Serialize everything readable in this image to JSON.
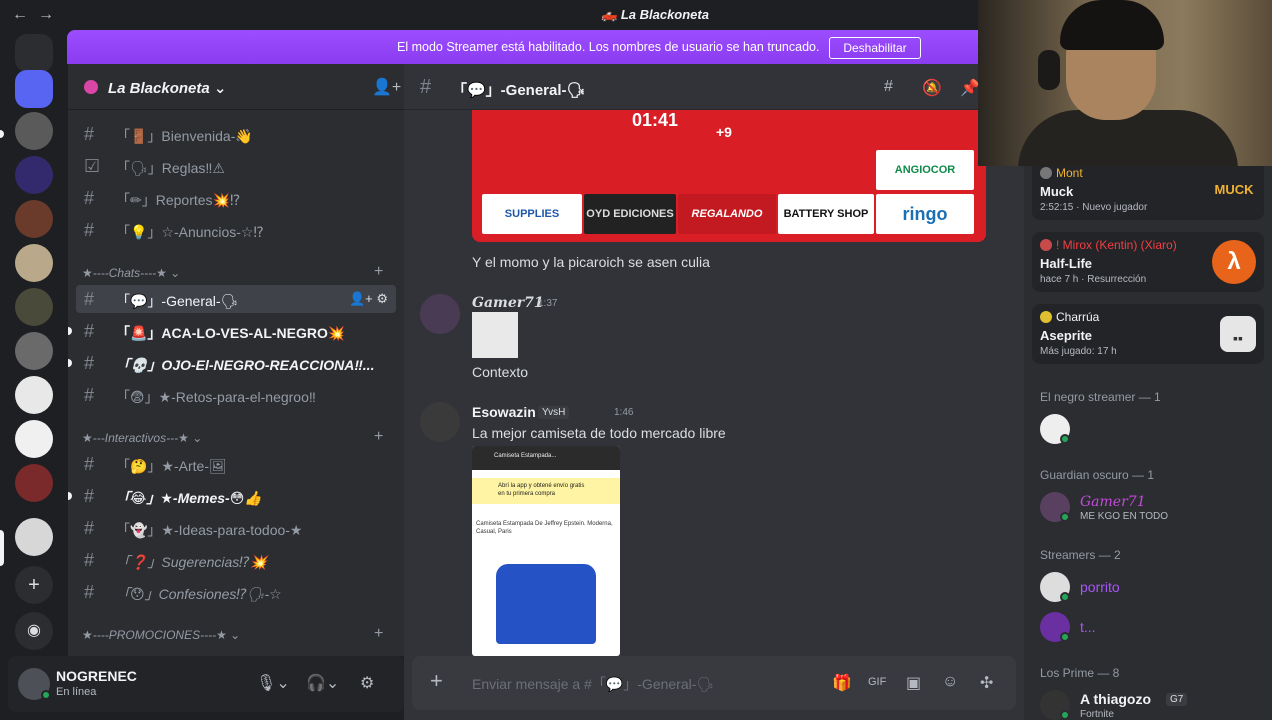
{
  "window": {
    "title": "La Blackoneta"
  },
  "banner": {
    "text": "El modo Streamer está habilitado. Los nombres de usuario se han truncado.",
    "button": "Deshabilitar"
  },
  "server": {
    "name": "La Blackoneta"
  },
  "channels": [
    {
      "label": "「🚪」Bienvenida-👋",
      "bold": false
    },
    {
      "label": "「🗣」Reglas‼⚠",
      "bold": false
    },
    {
      "label": "「✏」Reportes💥⁉",
      "bold": false
    },
    {
      "label": "「💡」☆-Anuncios-☆⁉",
      "bold": false
    }
  ],
  "categories": {
    "chats": "★----Chats----★",
    "interactivos": "★---Interactivos---★",
    "promociones": "★----PROMOCIONES----★"
  },
  "chat_channels": [
    {
      "label": "「💬」-General-🗣",
      "active": true
    },
    {
      "label": "「🚨」ACA-LO-VES-AL-NEGRO💥",
      "bold": true
    },
    {
      "label": "「💀」OJO-El-NEGRO-REACCIONA‼...",
      "bold": true
    },
    {
      "label": "「😨」★-Retos-para-el-negroo‼",
      "bold": false
    }
  ],
  "interactive_channels": [
    {
      "label": "「🤔」★-Arte-🖼",
      "bold": false
    },
    {
      "label": "「😂」★-Memes-😳👍",
      "bold": true
    },
    {
      "label": "「👻」★-Ideas-para-todoo-★",
      "bold": false
    },
    {
      "label": "「❓」Sugerencias⁉💥",
      "bold": false
    },
    {
      "label": "「😯」Confesiones⁉🗣-☆",
      "bold": false
    }
  ],
  "user": {
    "name": "NOGRENEC",
    "status": "En línea"
  },
  "channel_header": {
    "name": "「💬」-General-🗣"
  },
  "image_banner": {
    "score": "01:41",
    "extra": "+9",
    "sponsors": [
      "SUPPLIES MEDICAL",
      "OYD EDICIONES",
      "REGALANDO PASIÓN",
      "BATTERY SHOP",
      "ringo",
      "ANGIOCOR"
    ]
  },
  "messages": [
    {
      "text": "Y el momo y la picaroich se asen culia"
    },
    {
      "author": "Gamer71",
      "time": "1:37",
      "text": "Contexto",
      "author_color": "#c04bd8"
    },
    {
      "author": "Esowazin",
      "time": "1:46",
      "tag": "YvsH",
      "text": "La mejor camiseta de todo mercado libre",
      "author_color": "#f2f3f5"
    }
  ],
  "phone_screenshot": {
    "title": "Camiseta Estampada...",
    "promo": "Abrí la app y obtené envío gratis en tu primera compra",
    "product": "Camiseta Estampada De Jeffrey Epstein. Moderna, Casual, Paris"
  },
  "composer": {
    "placeholder": "Enviar mensaje a #「💬」-General-🗣"
  },
  "activities": [
    {
      "who": "Mont",
      "game": "Muck",
      "meta": "2:52:15 · Nuevo jugador",
      "who_color": "#f0b232",
      "logo": "MUCK"
    },
    {
      "who": "! Mirox (Kentin) (Xiaro)",
      "game": "Half-Life",
      "meta": "hace 7 h · Resurrección",
      "who_color": "#f23f43",
      "logo": "λ"
    },
    {
      "who": "Charrúa",
      "game": "Aseprite",
      "meta": "Más jugado: 17 h",
      "who_color": "#f2f3f5",
      "logo": "▪▪"
    }
  ],
  "member_groups": [
    {
      "header": "El negro streamer — 1",
      "members": [
        {
          "name": "",
          "sub": "",
          "color": "#dbdee1"
        }
      ]
    },
    {
      "header": "Guardian oscuro — 1",
      "members": [
        {
          "name": "Gamer71",
          "sub": "ME KGO EN TODO",
          "color": "#c04bd8"
        }
      ]
    },
    {
      "header": "Streamers — 2",
      "members": [
        {
          "name": "porrito",
          "sub": "",
          "color": "#a855f7"
        },
        {
          "name": "t...",
          "sub": "",
          "color": "#a855f7"
        }
      ]
    },
    {
      "header": "Los Prime — 8",
      "members": [
        {
          "name": "A thiagozo",
          "sub": "Fortnite",
          "color": "#f2f3f5",
          "tag": "G7"
        }
      ]
    }
  ]
}
